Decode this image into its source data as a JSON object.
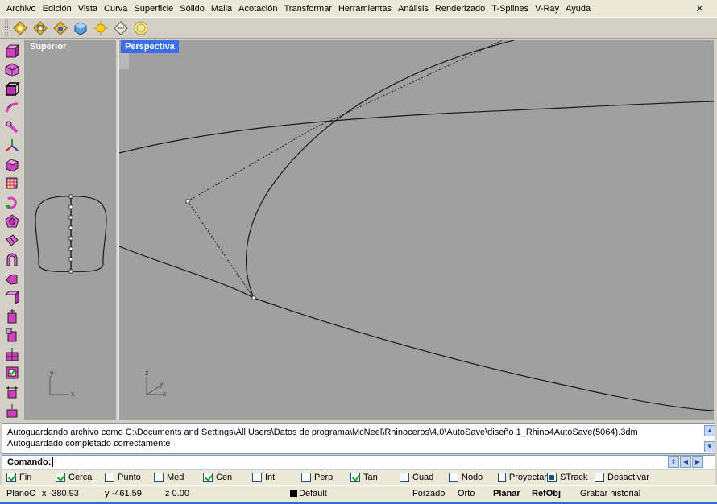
{
  "menu": [
    "Archivo",
    "Edición",
    "Vista",
    "Curva",
    "Superficie",
    "Sólido",
    "Malla",
    "Acotación",
    "Transformar",
    "Herramientas",
    "Análisis",
    "Renderizado",
    "T-Splines",
    "V-Ray",
    "Ayuda"
  ],
  "window_close_glyph": "✕",
  "toolbar_icons": [
    "new-icon",
    "open-icon",
    "save-icon",
    "render-icon",
    "light-icon",
    "layer-icon",
    "info-icon"
  ],
  "left_tools": [
    "box-icon",
    "sphere-icon",
    "cube-edges-icon",
    "sweep-icon",
    "revolve-icon",
    "axis-icon",
    "solid-box-icon",
    "grid-points-icon",
    "rotate-icon",
    "polygon-icon",
    "surface-icon",
    "arch-icon",
    "wedge-icon",
    "extrude-icon",
    "boolean-union-icon",
    "boolean-diff-icon",
    "split-icon",
    "check-box-icon",
    "move-icon",
    "scale-icon"
  ],
  "viewports": {
    "top": {
      "label": "Superior",
      "axis_x": "x",
      "axis_y": "y"
    },
    "perspective": {
      "label": "Perspectiva",
      "axis_x": "x",
      "axis_y": "y",
      "axis_z": "z"
    }
  },
  "history": {
    "line1": "Autoguardando archivo como C:\\Documents and Settings\\All Users\\Datos de programa\\McNeel\\Rhinoceros\\4.0\\AutoSave\\diseño 1_Rhino4AutoSave(5064).3dm",
    "line2": "Autoguardado completado correctamente"
  },
  "command": {
    "label": "Comando:",
    "value": ""
  },
  "osnaps": [
    {
      "label": "Fin",
      "checked": true
    },
    {
      "label": "Cerca",
      "checked": true
    },
    {
      "label": "Punto",
      "checked": false
    },
    {
      "label": "Med",
      "checked": false
    },
    {
      "label": "Cen",
      "checked": true
    },
    {
      "label": "Int",
      "checked": false
    },
    {
      "label": "Perp",
      "checked": false
    },
    {
      "label": "Tan",
      "checked": true
    },
    {
      "label": "Cuad",
      "checked": false
    },
    {
      "label": "Nodo",
      "checked": false
    },
    {
      "label": "Proyectar",
      "checked": false
    },
    {
      "label": "STrack",
      "checked": "filled"
    },
    {
      "label": "Desactivar",
      "checked": false
    }
  ],
  "status": {
    "plane": "PlanoC",
    "x": "x -380.93",
    "y": "y -461.59",
    "z": "z 0.00",
    "layer": "Default",
    "snap": "Forzado",
    "ortho": "Orto",
    "planar": "Planar",
    "osnap": "RefObj",
    "history": "Grabar historial"
  },
  "colors": {
    "viewport_bg": "#a0a0a0",
    "active_tab": "#3a6ee8",
    "curve": "#1a1a1a"
  }
}
